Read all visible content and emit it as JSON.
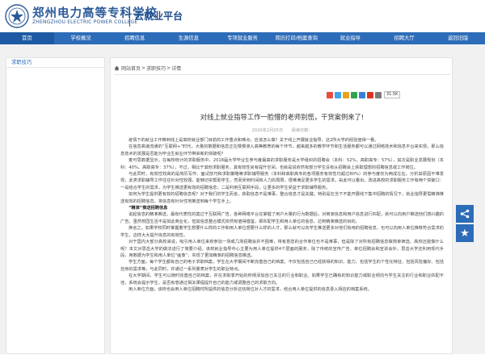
{
  "brand": {
    "title_cn": "郑州电力高等专科学校",
    "title_en": "ZHENGZHOU ELECTRIC POWER COLLEGE",
    "platform_name": "云就业平台"
  },
  "nav": {
    "items": [
      "首页",
      "学校概况",
      "招聘信息",
      "生源信息",
      "专项就业服务",
      "简历打印/档案查询",
      "就业指导",
      "招聘大厅",
      "返回旧版"
    ]
  },
  "sidebar": {
    "item": "求职技巧"
  },
  "breadcrumb": {
    "home": "网站首页",
    "sep": ">",
    "section": "求职技巧",
    "current": "详情"
  },
  "share": {
    "count": "31.5K",
    "colors": [
      "#e74c3c",
      "#3ea6ea",
      "#e9a21b",
      "#2fa34e",
      "#3b7fd6",
      "#d9341d",
      "#7a7a7a"
    ]
  },
  "article": {
    "title": "对线上就业指导工作一脸懵的老师别慌，干货案例来了!",
    "date": "2020年2月25日　　阅读次数：",
    "paragraphs": [
      "疫情下的就业工作推到线上是高校就业部门目前的工作重点和难点。应该怎么做？关于线上开展就业指导，这2所大学的经验值得一看。",
      "在信息高速流通的“互联网+”时代，大量的数据和信息正在慢慢渗入高等教育的每个环节，越来越多的教学环节和生活服务都可以通过网络技术和信息平台来实现，那么信息技术的发展是否能为毕业生就业环节带来新的突破呢？",
      "麦可思数据显示，在每校统计的求职服务中，2018届大学毕业生参与度最高的求职服务是大学组织的招聘会（本科：52%，高职高专：57%），其次是职业发展规划（本科：40%、高职高专：37%），不过，相比于其他求职服务，其有效性尚有提升空间，也就是说依然有部分学生没有从招聘会上获取理想的招聘信息或工作岗位。",
      "与此同时，有效性较高的是简历写作、面试技巧和求职策略等求职辅导服务（本科和高职高专的各项服务有效性均超过80%）的参与度仅为两成左右。分析其原因不难发现，此类求职辅导工作往往针对性较强，能够切实帮助学生，然而受到时间和人力的局限，很难满足更多学生的需求。由此可以看出，改进高校的求职服务工作有两个突破口：一是结合学生的需求，为学生推送更有效的招聘信息；二是利用互联网手段，让更多的学生受益于求职辅导服务。",
      "如何为学生提供更有效的招聘信息呢？对于我们的学生而言，获取信息不是难事，整合信息才是关键。特别是在当下不能开展线下集中招聘的情况下，就业指导更需精准推送有效的招聘信息，将信息有针对性地推送到每个学生手上。"
    ],
    "subhead": "“精准”推送招聘信息",
    "paragraphs2": [
      "说起信息的精准推送，最有代表性的莫过于互联网广告，各种网络平台在掌握了用户大量的行为数据后，对商家信息和用户信息进行匹配，就可以向用户推送他们感兴趣的广告。虽然校园生活不是如此商业化，但其信息整合模式依然有值得借鉴，即匹配学生和用人单位的信息，达到精准推送的目的。",
      "换言之，如果学校同时掌握着学生想要什么样的工作和用人单位想要什么样的人才，那么就可以向学生推送更多对他们有用的招聘信息，也可以向用人单位推荐符合需求的学生，这样大大提升信息的有效性。",
      "对于国内大部分高校来说，吸引用人单位来校参加一场或几场招聘会并不困难，将有意愿的合作单位也不是难事，但是除了对所有招聘信息做简单筛选、高校还能做什么呢？本文对思岳大学的做法进行了简要介绍。该校就业指导中心主要为用人单位提供4个层面的服务，除了传统的宣传广告、单位招聘会和宣讲会外，思岳大学还利用现代手段，用数据为学生和用人单位“画像”，实现了更加精准的招聘信息推送。",
      "学生方面，每个学生都有自己的电子求职档案，学生在大学期间不断完善自己的档案，不仅包括自己已经获得的知识、能力、包括学生的个性化特征、包括风险偏好、包括自身的需求等，与此同时，并通过一系列量表对学生的职业特点。",
      "在大学期间，学生可以随时完善自己的档案，并在求职季开始的时候添加自己关注的行业和职业。如果学生已确有的知识能力或职业倾向与学生关注的行业和职业匹配不佳，系统会提示学生，是否有意通过相关课程提升自己的能力或调整自己的求职方向。",
      "用人单位方面，该校也会用人单位招聘时所提供的信息分析这些岗位对人才的需求，结合用人单位提供的信息录入相应的档案系统。"
    ]
  }
}
